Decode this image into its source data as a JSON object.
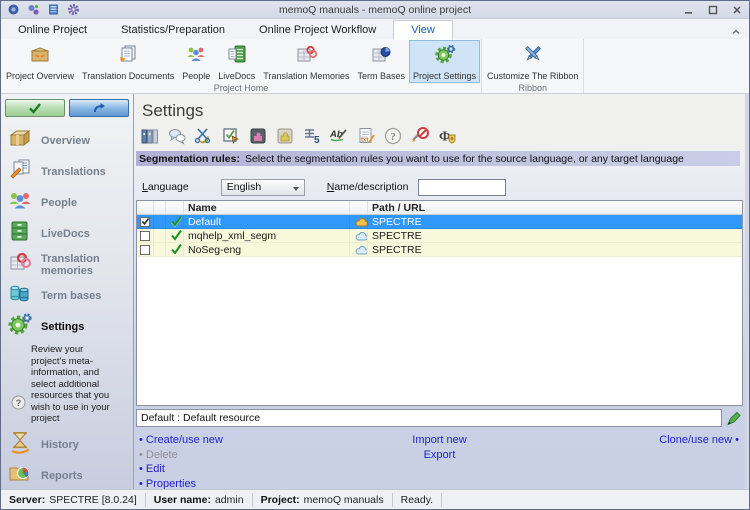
{
  "window": {
    "title": "memoQ manuals - memoQ online project"
  },
  "titlebar_icons": [
    "memoq-logo-icon",
    "sync-gears-icon",
    "project-book-icon",
    "options-gear-icon"
  ],
  "window_controls": [
    "minimize-icon",
    "maximize-icon",
    "close-icon"
  ],
  "tabs": [
    {
      "label": "Online Project"
    },
    {
      "label": "Statistics/Preparation"
    },
    {
      "label": "Online Project Workflow"
    },
    {
      "label": "View",
      "active": true
    }
  ],
  "ribbon": {
    "buttons": [
      {
        "label": "Project Overview"
      },
      {
        "label": "Translation Documents"
      },
      {
        "label": "People"
      },
      {
        "label": "LiveDocs"
      },
      {
        "label": "Translation Memories"
      },
      {
        "label": "Term Bases"
      },
      {
        "label": "Project Settings",
        "active": true
      },
      {
        "label": "Customize The Ribbon"
      }
    ],
    "group_labels": [
      "Project Home",
      "Ribbon"
    ]
  },
  "sidebar": {
    "wizard_buttons": [
      "confirm-check-button",
      "navigate-arrow-button"
    ],
    "items": [
      {
        "label": "Overview"
      },
      {
        "label": "Translations"
      },
      {
        "label": "People"
      },
      {
        "label": "LiveDocs"
      },
      {
        "label": "Translation memories"
      },
      {
        "label": "Term bases"
      },
      {
        "label": "Settings",
        "active": true
      },
      {
        "label": "History"
      },
      {
        "label": "Reports"
      }
    ],
    "settings_description": "Review your project's meta-information, and select additional resources that you wish to use in your project"
  },
  "settings": {
    "title": "Settings",
    "toolstrip_icons": [
      "binders-icon",
      "chat-bubbles-icon",
      "scissors-icon",
      "checkbox-arrow-icon",
      "puzzle-dark-icon",
      "puzzle-light-icon",
      "number-five-icon",
      "abc-pen-icon",
      "document-pen-icon",
      "question-mark-icon",
      "no-entry-pen-icon",
      "phi-shield-icon"
    ],
    "banner": {
      "label": "Segmentation rules:",
      "text": "Select the segmentation rules you want to use for the source language, or any target language"
    },
    "filters": {
      "language_label": "Language",
      "language_value": "English",
      "name_label": "Name/description",
      "name_value": ""
    },
    "table": {
      "col_name": "Name",
      "col_path": "Path / URL",
      "rows": [
        {
          "checked": true,
          "selected": true,
          "name": "Default",
          "path": "SPECTRE",
          "location_icon": "cloud-gold-icon"
        },
        {
          "checked": false,
          "selected": false,
          "name": "mqhelp_xml_segm",
          "path": "SPECTRE",
          "location_icon": "cloud-blue-icon"
        },
        {
          "checked": false,
          "selected": false,
          "name": "NoSeg-eng",
          "path": "SPECTRE",
          "location_icon": "cloud-blue-icon"
        }
      ]
    },
    "description_value": "Default : Default resource",
    "actions": {
      "create": "Create/use new",
      "delete": "Delete",
      "edit": "Edit",
      "properties": "Properties",
      "import": "Import new",
      "export": "Export",
      "clone": "Clone/use new"
    }
  },
  "statusbar": {
    "server_label": "Server:",
    "server_value": "SPECTRE [8.0.24]",
    "user_label": "User name:",
    "user_value": "admin",
    "project_label": "Project:",
    "project_value": "memoQ manuals",
    "ready": "Ready."
  },
  "colors": {
    "selection_blue": "#3097fb",
    "row_yellow": "#f8f8dc",
    "link_blue": "#2222cc",
    "banner_purple": "#b2b0d4",
    "settings_gear_green": "#56a53a"
  }
}
